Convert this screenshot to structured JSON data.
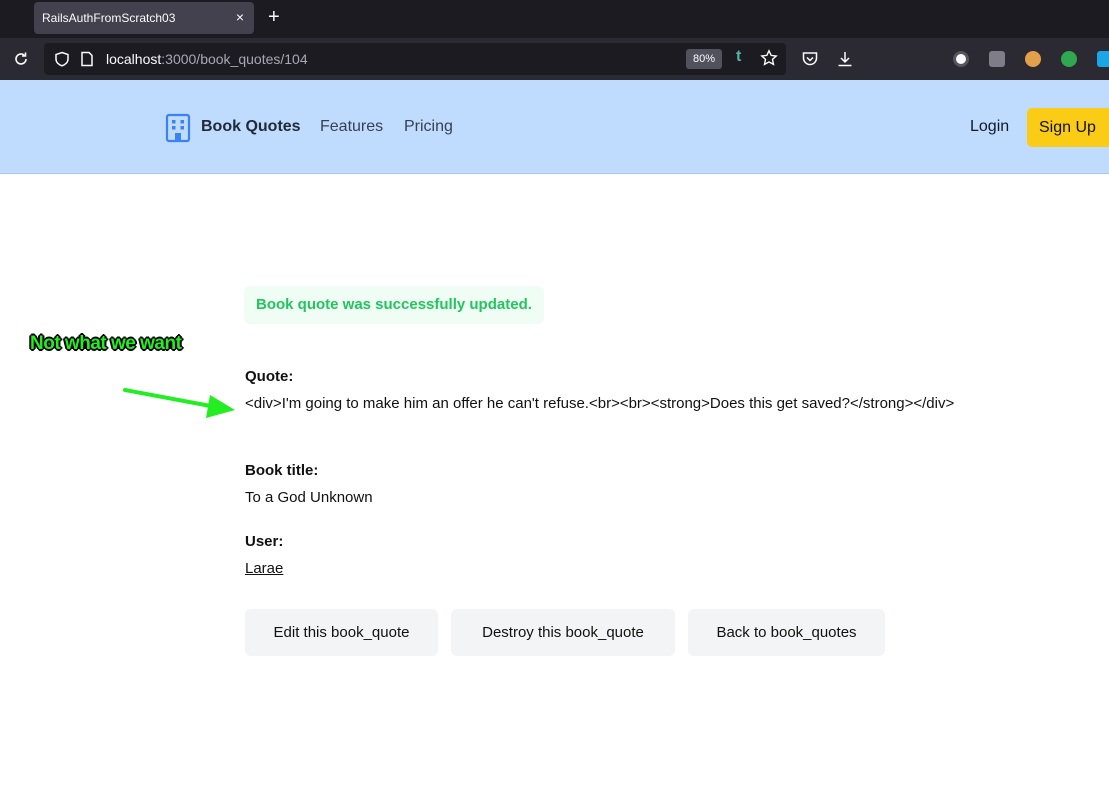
{
  "browser": {
    "tab_title": "RailsAuthFromScratch03",
    "tab_close": "×",
    "new_tab": "+",
    "url_host": "localhost",
    "url_rest": ":3000/book_quotes/104",
    "zoom": "80%",
    "t_extension": "t"
  },
  "header": {
    "brand": "Book Quotes",
    "nav": [
      "Features",
      "Pricing"
    ],
    "login": "Login",
    "signup": "Sign Up"
  },
  "notice": "Book quote was successfully updated.",
  "quote": {
    "label": "Quote:",
    "value": "<div>I'm going to make him an offer he can't refuse.<br><br><strong>Does this get saved?</strong></div>"
  },
  "book_title": {
    "label": "Book title:",
    "value": "To a God Unknown"
  },
  "user": {
    "label": "User:",
    "value": "Larae"
  },
  "actions": {
    "edit": "Edit this book_quote",
    "destroy": "Destroy this book_quote",
    "back": "Back to book_quotes"
  },
  "annotation": {
    "text": "Not what we want",
    "color": "#22ee22"
  },
  "colors": {
    "header_bg": "#bfdbfe",
    "signup_bg": "#facc15",
    "notice_text": "#22c55e",
    "notice_bg": "#f0fdf4"
  }
}
